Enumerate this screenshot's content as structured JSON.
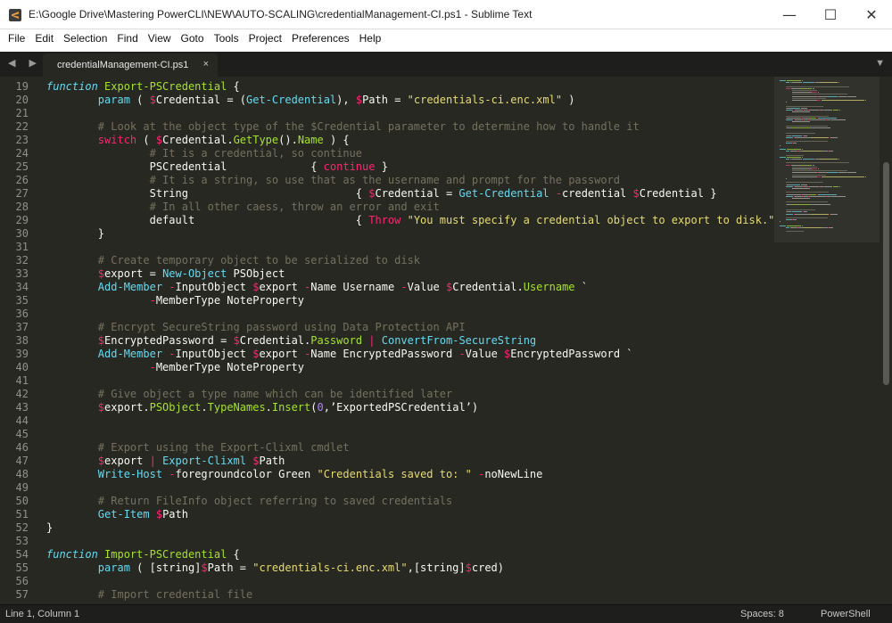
{
  "window": {
    "title": "E:\\Google Drive\\Mastering PowerCLI\\NEW\\AUTO-SCALING\\credentialManagement-CI.ps1 - Sublime Text",
    "minimize_glyph": "—",
    "maximize_glyph": "☐",
    "close_glyph": "✕"
  },
  "menu": [
    "File",
    "Edit",
    "Selection",
    "Find",
    "View",
    "Goto",
    "Tools",
    "Project",
    "Preferences",
    "Help"
  ],
  "tabs": {
    "nav_glyph": "◀ ▶",
    "active_tab": "credentialManagement-CI.ps1",
    "close_glyph": "×",
    "dropdown_glyph": "▼"
  },
  "editor": {
    "lines": [
      {
        "n": "19",
        "tokens": [
          [
            "def",
            "function"
          ],
          [
            "pl",
            " "
          ],
          [
            "ent",
            "Export-PSCredential"
          ],
          [
            "pl",
            " {"
          ]
        ]
      },
      {
        "n": "20",
        "tokens": [
          [
            "pl",
            "        "
          ],
          [
            "fn",
            "param"
          ],
          [
            "pl",
            " ( "
          ],
          [
            "kw",
            "$"
          ],
          [
            "pl",
            "Credential = ("
          ],
          [
            "fn",
            "Get-Credential"
          ],
          [
            "pl",
            "), "
          ],
          [
            "kw",
            "$"
          ],
          [
            "pl",
            "Path = "
          ],
          [
            "str",
            "\"credentials-ci.enc.xml\""
          ],
          [
            "pl",
            " )"
          ]
        ]
      },
      {
        "n": "21",
        "tokens": []
      },
      {
        "n": "22",
        "tokens": [
          [
            "pl",
            "        "
          ],
          [
            "cm",
            "# Look at the object type of the $Credential parameter to determine how to handle it"
          ]
        ]
      },
      {
        "n": "23",
        "tokens": [
          [
            "pl",
            "        "
          ],
          [
            "kw",
            "switch"
          ],
          [
            "pl",
            " ( "
          ],
          [
            "kw",
            "$"
          ],
          [
            "pl",
            "Credential."
          ],
          [
            "ent",
            "GetType"
          ],
          [
            "pl",
            "()."
          ],
          [
            "ent",
            "Name"
          ],
          [
            "pl",
            " ) {"
          ]
        ]
      },
      {
        "n": "24",
        "tokens": [
          [
            "pl",
            "                "
          ],
          [
            "cm",
            "# It is a credential, so continue"
          ]
        ]
      },
      {
        "n": "25",
        "tokens": [
          [
            "pl",
            "                PSCredential             { "
          ],
          [
            "kw",
            "continue"
          ],
          [
            "pl",
            " }"
          ]
        ]
      },
      {
        "n": "26",
        "tokens": [
          [
            "pl",
            "                "
          ],
          [
            "cm",
            "# It is a string, so use that as the username and prompt for the password"
          ]
        ]
      },
      {
        "n": "27",
        "tokens": [
          [
            "pl",
            "                String                          { "
          ],
          [
            "kw",
            "$"
          ],
          [
            "pl",
            "Credential = "
          ],
          [
            "fn",
            "Get-Credential"
          ],
          [
            "pl",
            " "
          ],
          [
            "kw",
            "-"
          ],
          [
            "pl",
            "credential "
          ],
          [
            "kw",
            "$"
          ],
          [
            "pl",
            "Credential }"
          ]
        ]
      },
      {
        "n": "28",
        "tokens": [
          [
            "pl",
            "                "
          ],
          [
            "cm",
            "# In all other caess, throw an error and exit"
          ]
        ]
      },
      {
        "n": "29",
        "tokens": [
          [
            "pl",
            "                default                         { "
          ],
          [
            "kw",
            "Throw"
          ],
          [
            "pl",
            " "
          ],
          [
            "str",
            "\"You must specify a credential object to export to disk.\""
          ],
          [
            "pl",
            " }"
          ]
        ]
      },
      {
        "n": "30",
        "tokens": [
          [
            "pl",
            "        }"
          ]
        ]
      },
      {
        "n": "31",
        "tokens": []
      },
      {
        "n": "32",
        "tokens": [
          [
            "pl",
            "        "
          ],
          [
            "cm",
            "# Create temporary object to be serialized to disk"
          ]
        ]
      },
      {
        "n": "33",
        "tokens": [
          [
            "pl",
            "        "
          ],
          [
            "kw",
            "$"
          ],
          [
            "pl",
            "export = "
          ],
          [
            "fn",
            "New-Object"
          ],
          [
            "pl",
            " PSObject"
          ]
        ]
      },
      {
        "n": "34",
        "tokens": [
          [
            "pl",
            "        "
          ],
          [
            "fn",
            "Add-Member"
          ],
          [
            "pl",
            " "
          ],
          [
            "kw",
            "-"
          ],
          [
            "pl",
            "InputObject "
          ],
          [
            "kw",
            "$"
          ],
          [
            "pl",
            "export "
          ],
          [
            "kw",
            "-"
          ],
          [
            "pl",
            "Name Username "
          ],
          [
            "kw",
            "-"
          ],
          [
            "pl",
            "Value "
          ],
          [
            "kw",
            "$"
          ],
          [
            "pl",
            "Credential."
          ],
          [
            "ent",
            "Username"
          ],
          [
            "pl",
            " `"
          ]
        ]
      },
      {
        "n": "35",
        "tokens": [
          [
            "pl",
            "                "
          ],
          [
            "kw",
            "-"
          ],
          [
            "pl",
            "MemberType NoteProperty"
          ]
        ]
      },
      {
        "n": "36",
        "tokens": []
      },
      {
        "n": "37",
        "tokens": [
          [
            "pl",
            "        "
          ],
          [
            "cm",
            "# Encrypt SecureString password using Data Protection API"
          ]
        ]
      },
      {
        "n": "38",
        "tokens": [
          [
            "pl",
            "        "
          ],
          [
            "kw",
            "$"
          ],
          [
            "pl",
            "EncryptedPassword = "
          ],
          [
            "kw",
            "$"
          ],
          [
            "pl",
            "Credential."
          ],
          [
            "ent",
            "Password"
          ],
          [
            "pl",
            " "
          ],
          [
            "kw",
            "|"
          ],
          [
            "pl",
            " "
          ],
          [
            "fn",
            "ConvertFrom-SecureString"
          ]
        ]
      },
      {
        "n": "39",
        "tokens": [
          [
            "pl",
            "        "
          ],
          [
            "fn",
            "Add-Member"
          ],
          [
            "pl",
            " "
          ],
          [
            "kw",
            "-"
          ],
          [
            "pl",
            "InputObject "
          ],
          [
            "kw",
            "$"
          ],
          [
            "pl",
            "export "
          ],
          [
            "kw",
            "-"
          ],
          [
            "pl",
            "Name EncryptedPassword "
          ],
          [
            "kw",
            "-"
          ],
          [
            "pl",
            "Value "
          ],
          [
            "kw",
            "$"
          ],
          [
            "pl",
            "EncryptedPassword `"
          ]
        ]
      },
      {
        "n": "40",
        "tokens": [
          [
            "pl",
            "                "
          ],
          [
            "kw",
            "-"
          ],
          [
            "pl",
            "MemberType NoteProperty"
          ]
        ]
      },
      {
        "n": "41",
        "tokens": []
      },
      {
        "n": "42",
        "tokens": [
          [
            "pl",
            "        "
          ],
          [
            "cm",
            "# Give object a type name which can be identified later"
          ]
        ]
      },
      {
        "n": "43",
        "tokens": [
          [
            "pl",
            "        "
          ],
          [
            "kw",
            "$"
          ],
          [
            "pl",
            "export."
          ],
          [
            "ent",
            "PSObject"
          ],
          [
            "pl",
            "."
          ],
          [
            "ent",
            "TypeNames"
          ],
          [
            "pl",
            "."
          ],
          [
            "ent",
            "Insert"
          ],
          [
            "pl",
            "("
          ],
          [
            "num",
            "0"
          ],
          [
            "pl",
            ",’ExportedPSCredential’)"
          ]
        ]
      },
      {
        "n": "44",
        "tokens": []
      },
      {
        "n": "45",
        "tokens": []
      },
      {
        "n": "46",
        "tokens": [
          [
            "pl",
            "        "
          ],
          [
            "cm",
            "# Export using the Export-Clixml cmdlet"
          ]
        ]
      },
      {
        "n": "47",
        "tokens": [
          [
            "pl",
            "        "
          ],
          [
            "kw",
            "$"
          ],
          [
            "pl",
            "export "
          ],
          [
            "kw",
            "|"
          ],
          [
            "pl",
            " "
          ],
          [
            "fn",
            "Export-Clixml"
          ],
          [
            "pl",
            " "
          ],
          [
            "kw",
            "$"
          ],
          [
            "pl",
            "Path"
          ]
        ]
      },
      {
        "n": "48",
        "tokens": [
          [
            "pl",
            "        "
          ],
          [
            "fn",
            "Write-Host"
          ],
          [
            "pl",
            " "
          ],
          [
            "kw",
            "-"
          ],
          [
            "pl",
            "foregroundcolor Green "
          ],
          [
            "str",
            "\"Credentials saved to: \""
          ],
          [
            "pl",
            " "
          ],
          [
            "kw",
            "-"
          ],
          [
            "pl",
            "noNewLine"
          ]
        ]
      },
      {
        "n": "49",
        "tokens": []
      },
      {
        "n": "50",
        "tokens": [
          [
            "pl",
            "        "
          ],
          [
            "cm",
            "# Return FileInfo object referring to saved credentials"
          ]
        ]
      },
      {
        "n": "51",
        "tokens": [
          [
            "pl",
            "        "
          ],
          [
            "fn",
            "Get-Item"
          ],
          [
            "pl",
            " "
          ],
          [
            "kw",
            "$"
          ],
          [
            "pl",
            "Path"
          ]
        ]
      },
      {
        "n": "52",
        "tokens": [
          [
            "pl",
            "}"
          ]
        ]
      },
      {
        "n": "53",
        "tokens": []
      },
      {
        "n": "54",
        "tokens": [
          [
            "def",
            "function"
          ],
          [
            "pl",
            " "
          ],
          [
            "ent",
            "Import-PSCredential"
          ],
          [
            "pl",
            " {"
          ]
        ]
      },
      {
        "n": "55",
        "tokens": [
          [
            "pl",
            "        "
          ],
          [
            "fn",
            "param"
          ],
          [
            "pl",
            " ( [string]"
          ],
          [
            "kw",
            "$"
          ],
          [
            "pl",
            "Path = "
          ],
          [
            "str",
            "\"credentials-ci.enc.xml\""
          ],
          [
            "pl",
            ",[string]"
          ],
          [
            "kw",
            "$"
          ],
          [
            "pl",
            "cred)"
          ]
        ]
      },
      {
        "n": "56",
        "tokens": []
      },
      {
        "n": "57",
        "tokens": [
          [
            "pl",
            "        "
          ],
          [
            "cm",
            "# Import credential file"
          ]
        ]
      }
    ]
  },
  "status": {
    "position": "Line 1, Column 1",
    "spaces": "Spaces: 8",
    "syntax": "PowerShell"
  },
  "colors": {
    "editor_bg": "#272822",
    "chrome_bg": "#1e1f1c",
    "keyword": "#f92672",
    "function": "#66d9ef",
    "entity": "#a6e22e",
    "string": "#e6db74",
    "comment": "#75715e"
  }
}
